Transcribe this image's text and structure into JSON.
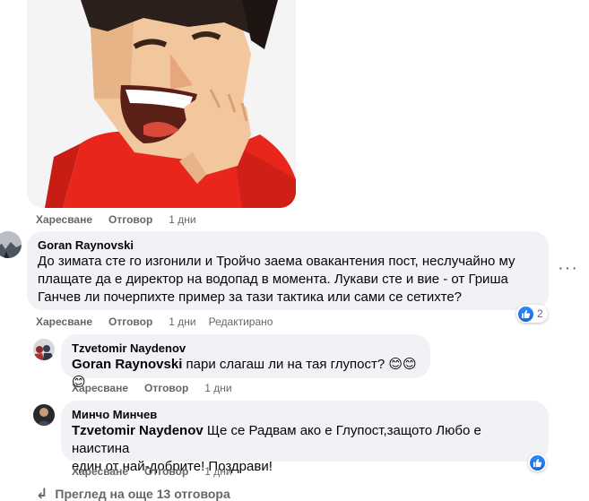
{
  "sticker": {
    "icon": "laughing-cartoon-sticker"
  },
  "post_actions": {
    "like": "Харесване",
    "reply": "Отговор",
    "time": "1 дни"
  },
  "comments": [
    {
      "author": "Goran Raynovski",
      "text": "До зимата сте го изгонили и Тройчо заема овакантения пост, неслучайно му\nплащате да е директор на водопад в момента. Лукави сте и вие - от Гриша\nГанчев ли почерпихте пример за тази тактика или сами се сетихте?",
      "like": "Харесване",
      "reply": "Отговор",
      "time": "1 дни",
      "edited": "Редактирано",
      "reactions": "2"
    }
  ],
  "replies": [
    {
      "author": "Tzvetomir Naydenov",
      "mention": "Goran Raynovski",
      "text": " пари слагаш ли на тая глупост?",
      "emojis": "😊😊😊",
      "like": "Харесване",
      "reply": "Отговор",
      "time": "1 дни"
    },
    {
      "author": "Минчо Минчев",
      "mention": "Tzvetomir Naydenov",
      "text": " Ще се Радвам ако е Глупост,защото Любо е наистина\nедин от най-добрите! Поздрави!",
      "like": "Харесване",
      "reply": "Отговор",
      "time": "1 дни"
    }
  ],
  "view_more": "Преглед на още 13 отговора",
  "colors": {
    "bubble": "#f0f2f5",
    "meta": "#65676b",
    "like_blue": "#1877f2"
  }
}
